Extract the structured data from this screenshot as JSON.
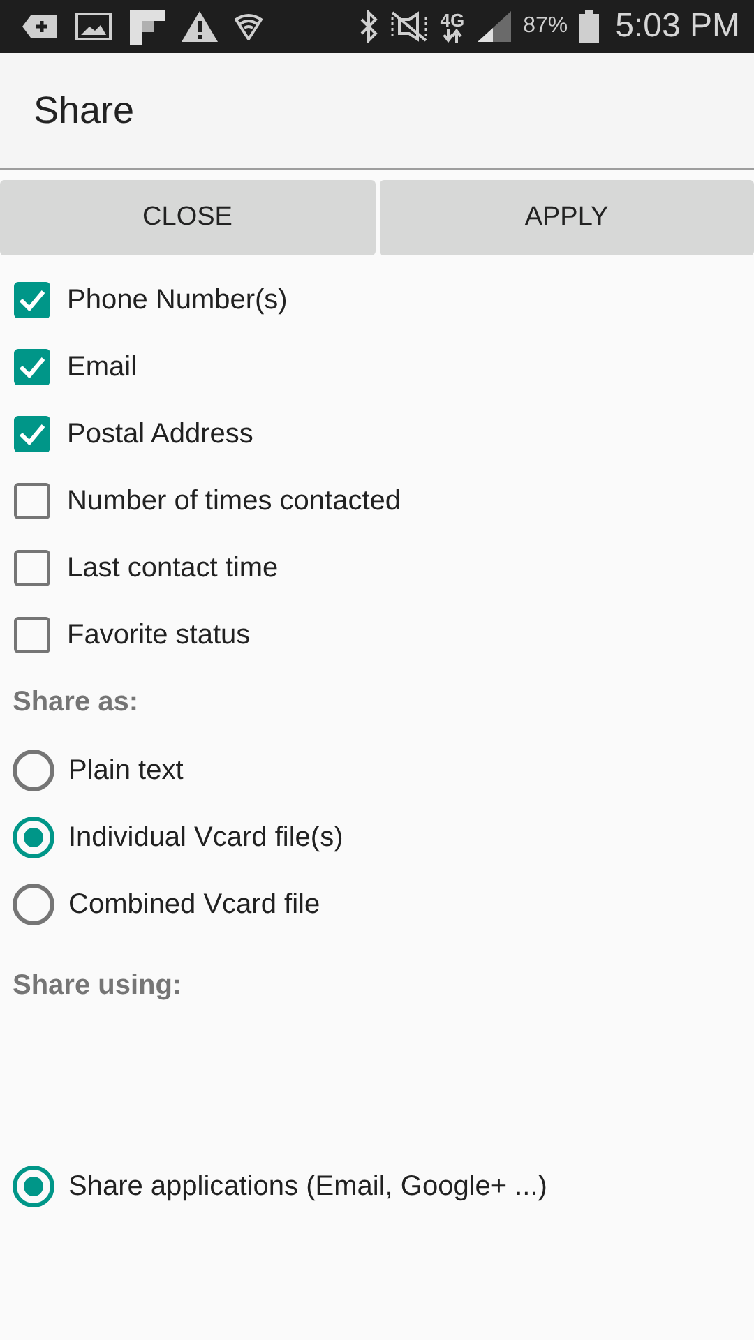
{
  "status_bar": {
    "network": "4G",
    "battery": "87%",
    "time": "5:03 PM"
  },
  "title": "Share",
  "buttons": [
    "CLOSE",
    "APPLY"
  ],
  "fields": [
    {
      "label": "Phone Number(s)",
      "checked": true
    },
    {
      "label": "Email",
      "checked": true
    },
    {
      "label": "Postal Address",
      "checked": true
    },
    {
      "label": "Number of times contacted",
      "checked": false
    },
    {
      "label": "Last contact time",
      "checked": false
    },
    {
      "label": "Favorite status",
      "checked": false
    }
  ],
  "share_as": {
    "label": "Share as:",
    "options": [
      {
        "label": "Plain text",
        "selected": false
      },
      {
        "label": "Individual Vcard file(s)",
        "selected": true
      },
      {
        "label": "Combined Vcard file",
        "selected": false
      }
    ]
  },
  "share_using": {
    "label": "Share using:",
    "options": [
      {
        "label": "Share applications (Email, Google+ ...)",
        "selected": true
      }
    ]
  }
}
